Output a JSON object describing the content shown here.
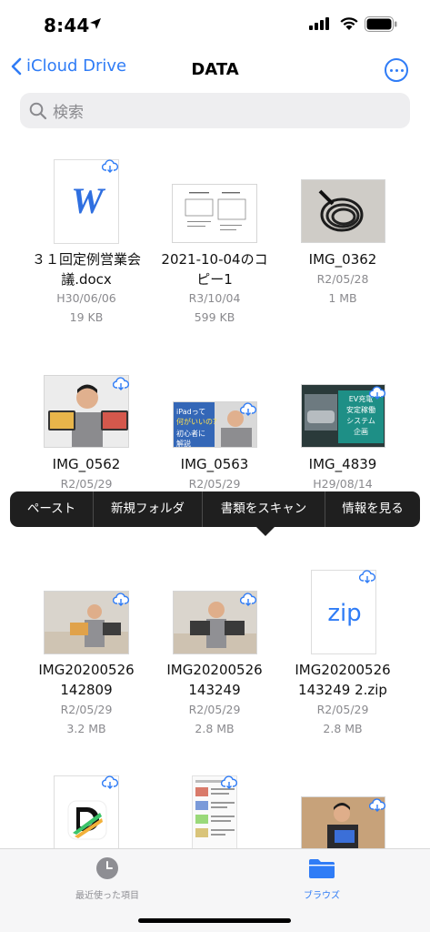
{
  "status_bar": {
    "time": "8:44"
  },
  "nav": {
    "back_label": "iCloud Drive",
    "title": "DATA"
  },
  "search": {
    "placeholder": "検索"
  },
  "files": [
    {
      "name": "３１回定例営業会議.docx",
      "date": "H30/06/06",
      "size": "19 KB",
      "type": "word"
    },
    {
      "name": "2021-10-04のコピー1",
      "date": "R3/10/04",
      "size": "599 KB",
      "type": "doc"
    },
    {
      "name": "IMG_0362",
      "date": "R2/05/28",
      "size": "1 MB",
      "type": "photo"
    },
    {
      "name": "IMG_0562",
      "date": "R2/05/29",
      "type": "photo"
    },
    {
      "name": "IMG_0563",
      "date": "R2/05/29",
      "type": "photo",
      "thumb_text_1": "iPadって",
      "thumb_text_2": "何がいいの？",
      "thumb_text_3": "初心者に",
      "thumb_text_4": "解説"
    },
    {
      "name": "IMG_4839",
      "date": "H29/08/14",
      "type": "photo",
      "thumb_text_1": "EV充電",
      "thumb_text_2": "安定稼働",
      "thumb_text_3": "システム",
      "thumb_text_4": "企画"
    },
    {
      "name_line1": "IMG20200526",
      "name_line2": "142809",
      "date": "R2/05/29",
      "size": "3.2 MB",
      "type": "photo"
    },
    {
      "name_line1": "IMG20200526",
      "name_line2": "143249",
      "date": "R2/05/29",
      "size": "2.8 MB",
      "type": "photo"
    },
    {
      "name_line1": "IMG20200526",
      "name_line2": "143249 2.zip",
      "date": "R2/05/29",
      "size": "2.8 MB",
      "type": "zip",
      "icon_text": "zip"
    },
    {
      "type": "app"
    },
    {
      "type": "doc"
    },
    {
      "type": "photo"
    }
  ],
  "context_menu": {
    "items": [
      "ペースト",
      "新規フォルダ",
      "書類をスキャン",
      "情報を見る"
    ]
  },
  "tabbar": {
    "recent_label": "最近使った項目",
    "browse_label": "ブラウズ"
  },
  "colors": {
    "accent": "#2f7cf6",
    "menu_bg": "#1f1f1f",
    "secondary_text": "#8a8a8e"
  }
}
